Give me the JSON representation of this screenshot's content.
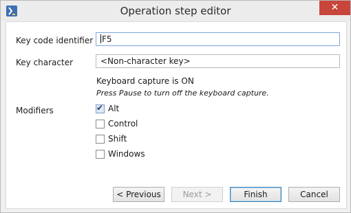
{
  "window": {
    "title": "Operation step editor",
    "close_glyph": "✕"
  },
  "form": {
    "key_code_label": "Key code identifier",
    "key_code_value": "F5",
    "key_char_label": "Key character",
    "key_char_value": "<Non-character key>",
    "capture_status": "Keyboard capture is ON",
    "capture_hint": "Press Pause to turn off the keyboard capture.",
    "modifiers_label": "Modifiers",
    "modifiers": [
      {
        "label": "Alt",
        "checked": true
      },
      {
        "label": "Control",
        "checked": false
      },
      {
        "label": "Shift",
        "checked": false
      },
      {
        "label": "Windows",
        "checked": false
      }
    ]
  },
  "buttons": {
    "previous": "< Previous",
    "next": "Next >",
    "finish": "Finish",
    "cancel": "Cancel"
  },
  "colors": {
    "close_bg": "#c7453b",
    "default_button_border": "#3c7fb1"
  }
}
